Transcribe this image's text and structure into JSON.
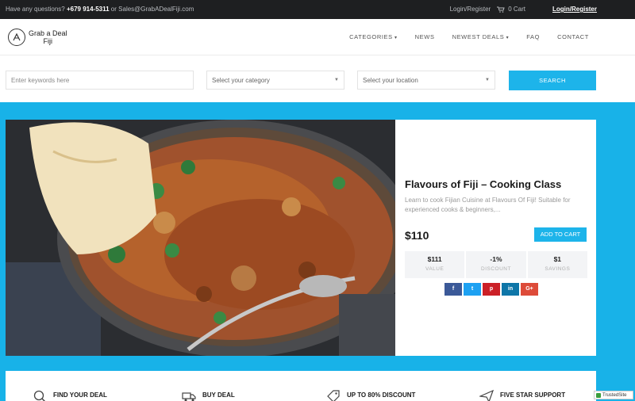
{
  "topbar": {
    "question": "Have any questions?",
    "phone": "+679 914-5311",
    "or": "or",
    "email": "Sales@GrabADealFiji.com",
    "login_register": "Login/Register",
    "cart": "0 Cart",
    "login_register_bold": "Login/Register"
  },
  "logo": {
    "line1": "Grab a Deal",
    "line2": "Fiji"
  },
  "nav": {
    "items": [
      "CATEGORIES",
      "NEWS",
      "NEWEST DEALS",
      "FAQ",
      "CONTACT"
    ]
  },
  "search": {
    "keywords_placeholder": "Enter keywords here",
    "category": "Select your category",
    "location": "Select your location",
    "button": "SEARCH"
  },
  "deal": {
    "title": "Flavours of Fiji – Cooking Class",
    "description": "Learn to cook Fijian Cuisine at Flavours Of Fiji! Suitable for experienced cooks & beginners,...",
    "price": "$110",
    "add_to_cart": "ADD TO CART",
    "stats": [
      {
        "value": "$111",
        "label": "VALUE"
      },
      {
        "value": "-1%",
        "label": "DISCOUNT"
      },
      {
        "value": "$1",
        "label": "SAVINGS"
      }
    ],
    "share": {
      "facebook": "f",
      "twitter": "t",
      "pinterest": "p",
      "linkedin": "in",
      "google": "G+"
    }
  },
  "features": {
    "find": "FIND YOUR DEAL",
    "buy": "BUY DEAL",
    "discount": "UP TO 80% DISCOUNT",
    "support": "FIVE STAR SUPPORT"
  },
  "trusted": "TrustedSite"
}
